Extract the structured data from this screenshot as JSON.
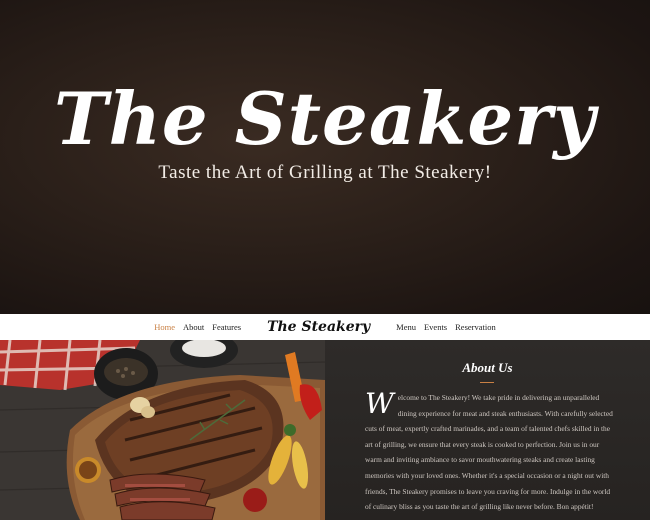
{
  "hero": {
    "title": "The Steakery",
    "tagline": "Taste the Art of Grilling at The Steakery!"
  },
  "nav": {
    "left_items": [
      "Home",
      "About",
      "Features"
    ],
    "logo": "The Steakery",
    "right_items": [
      "Menu",
      "Events",
      "Reservation"
    ],
    "active_item": "Home"
  },
  "about": {
    "title": "About Us",
    "dropcap": "W",
    "body": "elcome to The Steakery! We take pride in delivering an unparalleled dining experience for meat and steak enthusiasts. With carefully selected cuts of meat, expertly crafted marinades, and a team of talented chefs skilled in the art of grilling, we ensure that every steak is cooked to perfection. Join us in our warm and inviting ambiance to savor mouthwatering steaks and create lasting memories with your loved ones. Whether it's a special occasion or a night out with friends, The Steakery promises to leave you craving for more. Indulge in the world of culinary bliss as you taste the art of grilling like never before. Bon appétit!"
  },
  "colors": {
    "accent": "#c98044",
    "hero_bg": "#2a1f19",
    "about_bg": "#2b2826"
  },
  "image": {
    "icon": "steak-photo"
  }
}
